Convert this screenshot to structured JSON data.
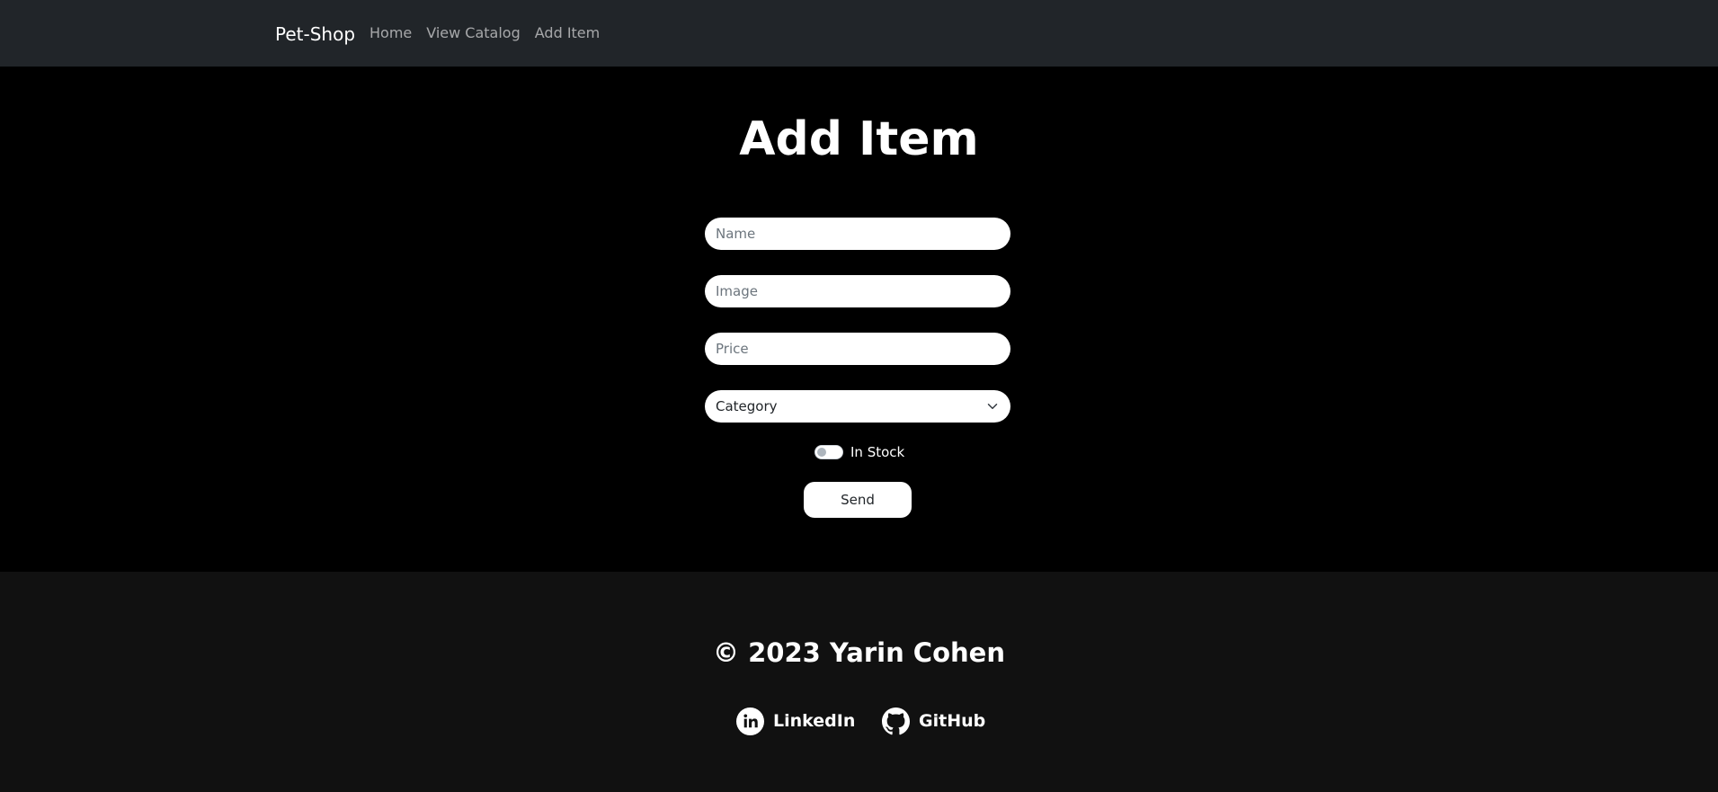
{
  "navbar": {
    "brand": "Pet-Shop",
    "links": [
      "Home",
      "View Catalog",
      "Add Item"
    ]
  },
  "main": {
    "title": "Add Item",
    "form": {
      "name_placeholder": "Name",
      "image_placeholder": "Image",
      "price_placeholder": "Price",
      "category_selected": "Category",
      "in_stock_label": "In Stock",
      "in_stock_checked": false,
      "send_label": "Send"
    }
  },
  "footer": {
    "copyright": "© 2023 Yarin Cohen",
    "social": [
      {
        "label": "LinkedIn",
        "icon": "linkedin-icon"
      },
      {
        "label": "GitHub",
        "icon": "github-icon"
      }
    ]
  },
  "colors": {
    "navbar_bg": "#212529",
    "main_bg": "#000000",
    "footer_bg": "#111111",
    "text_light": "#ffffff",
    "nav_link": "#9a9da0"
  }
}
